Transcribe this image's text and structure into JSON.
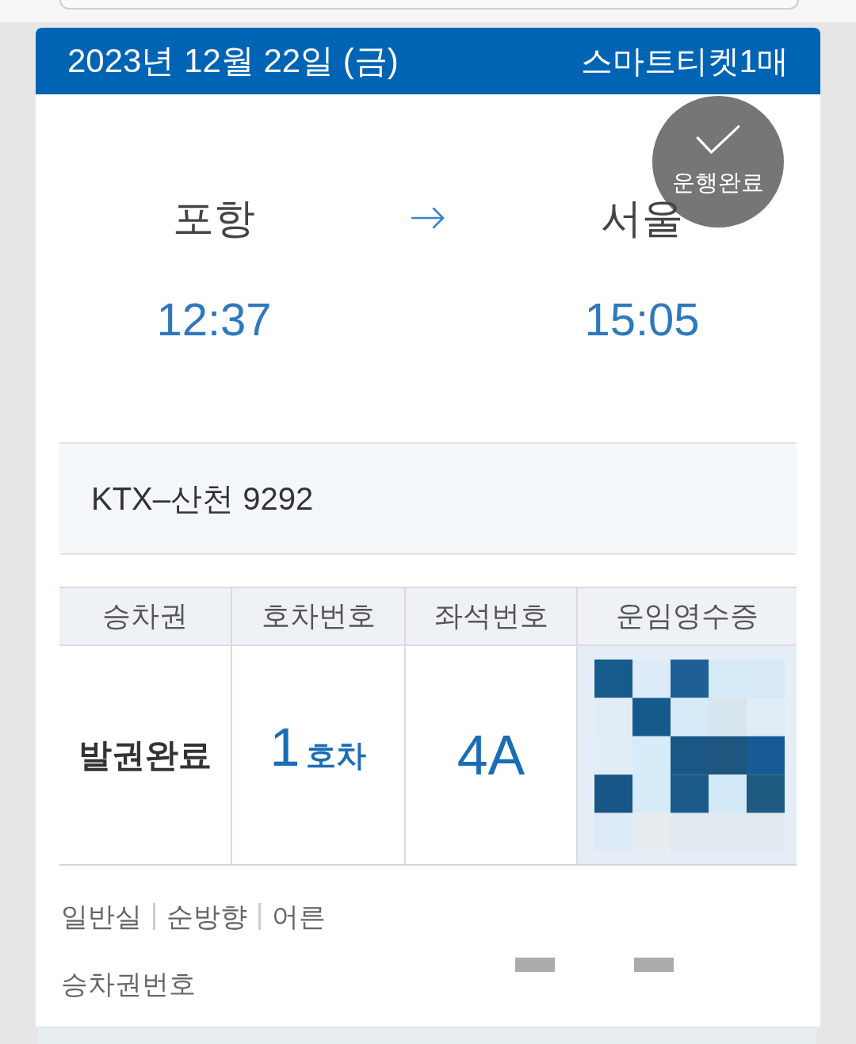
{
  "header": {
    "date": "2023년 12월 22일 (금)",
    "ticket_count": "스마트티켓1매"
  },
  "status_stamp": {
    "label": "운행완료"
  },
  "route": {
    "departure": {
      "station": "포항",
      "time": "12:37"
    },
    "arrival": {
      "station": "서울",
      "time": "15:05"
    }
  },
  "train": {
    "name": "KTX–산천 9292"
  },
  "ticket_table": {
    "columns": [
      "승차권",
      "호차번호",
      "좌석번호",
      "운임영수증"
    ],
    "cells": [
      {
        "kind": "status",
        "text": "발권완료"
      },
      {
        "kind": "car",
        "number": "1",
        "unit": "호차"
      },
      {
        "kind": "seat",
        "text": "4A"
      },
      {
        "kind": "receipt_code"
      }
    ]
  },
  "details": {
    "tags": [
      "일반실",
      "순방향",
      "어른"
    ],
    "ticket_number_label": "승차권번호"
  }
}
